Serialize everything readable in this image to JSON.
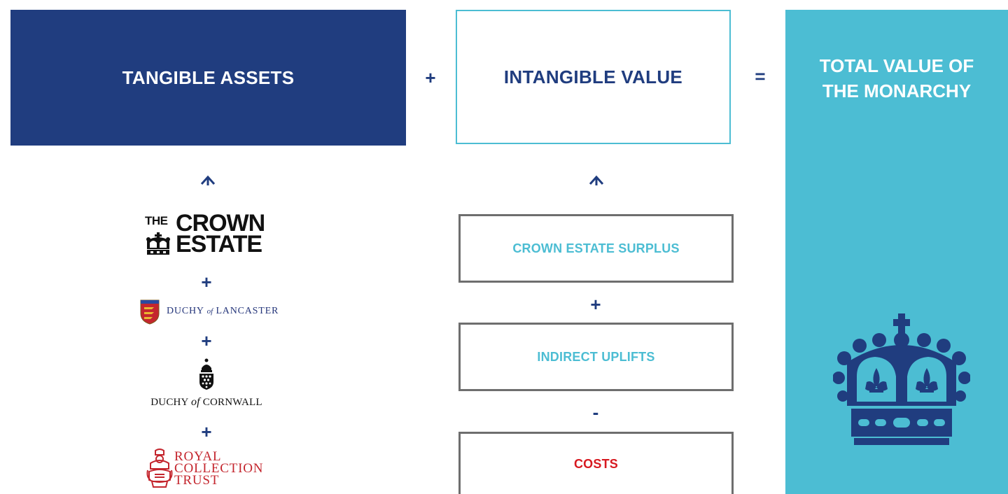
{
  "tangible": {
    "title": "TANGIBLE ASSETS"
  },
  "intangible": {
    "title": "INTANGIBLE VALUE"
  },
  "total": {
    "title_line1": "TOTAL VALUE OF",
    "title_line2": "THE MONARCHY",
    "icon": "crown-icon"
  },
  "operators": {
    "plus": "+",
    "equals": "=",
    "minus": "-"
  },
  "tangible_components": {
    "crown_estate": {
      "line_the": "THE",
      "line_crown": "CROWN",
      "line_estate": "ESTATE"
    },
    "duchy_lancaster": {
      "prefix": "DUCHY",
      "of": "of",
      "name": "LANCASTER"
    },
    "duchy_cornwall": {
      "prefix": "DUCHY",
      "of": "of",
      "name": "CORNWALL"
    },
    "royal_collection": {
      "line1": "ROYAL",
      "line2": "COLLECTION",
      "line3": "TRUST"
    }
  },
  "intangible_components": [
    {
      "label": "CROWN ESTATE SURPLUS",
      "color": "#4cbdd3"
    },
    {
      "label": "INDIRECT UPLIFTS",
      "color": "#4cbdd3"
    },
    {
      "label": "COSTS",
      "color": "#d71920"
    }
  ],
  "colors": {
    "navy": "#203d7f",
    "teal": "#4cbdd3",
    "red": "#d71920",
    "border_gray": "#6e6e6e"
  }
}
